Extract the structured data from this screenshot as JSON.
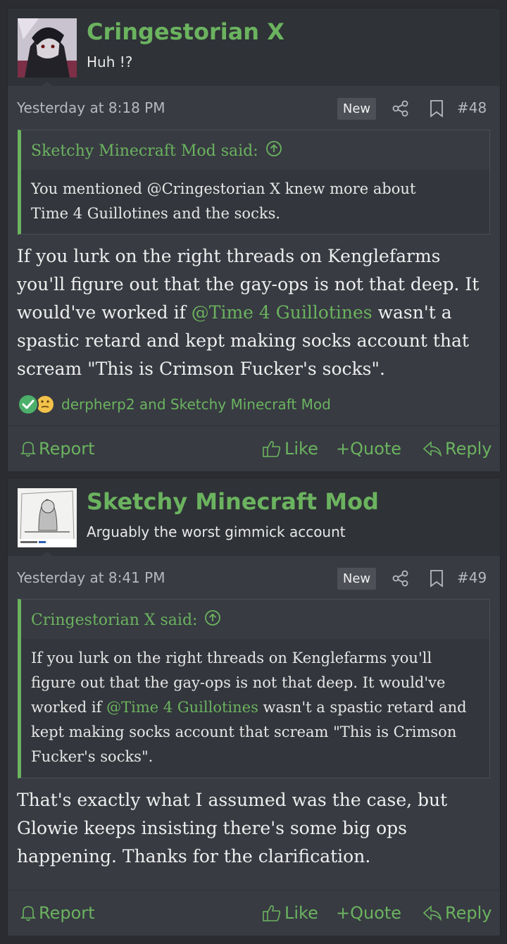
{
  "posts": [
    {
      "username": "Cringestorian X",
      "user_title": "Huh !?",
      "date": "Yesterday at 8:18 PM",
      "badge": "New",
      "number": "#48",
      "quote": {
        "author": "Sketchy Minecraft Mod said:",
        "lines": [
          "You mentioned @Cringestorian X knew more about",
          "Time 4 Guillotines and the socks."
        ]
      },
      "message": {
        "line1": "If you lurk on the right threads on Kenglefarms",
        "line2": "you'll figure out that the gay-ops is not that deep. It",
        "line3_pre": "would've worked if ",
        "line3_mention": "@Time 4 Guillotines",
        "line3_post": " wasn't a",
        "line4": "spastic retard and kept making socks account that",
        "line5": "scream \"This is Crimson Fucker's socks\"."
      },
      "reactions": "derpherp2 and Sketchy Minecraft Mod",
      "footer": {
        "report": "Report",
        "like": "Like",
        "quote": "+Quote",
        "reply": "Reply"
      }
    },
    {
      "username": "Sketchy Minecraft Mod",
      "user_title": "Arguably the worst gimmick account",
      "date": "Yesterday at 8:41 PM",
      "badge": "New",
      "number": "#49",
      "quote": {
        "author": "Cringestorian X said:",
        "line1": "If you lurk on the right threads on Kenglefarms you'll",
        "line2": "figure out that the gay-ops is not that deep. It would've",
        "line3_pre": "worked if ",
        "line3_mention": "@Time 4 Guillotines",
        "line3_post": " wasn't a spastic retard and",
        "line4": "kept making socks account that scream \"This is Crimson",
        "line5": "Fucker's socks\"."
      },
      "message": {
        "line1": "That's exactly what I assumed was the case, but",
        "line2": "Glowie keeps insisting there's some big ops",
        "line3": "happening. Thanks for the clarification."
      },
      "footer": {
        "report": "Report",
        "like": "Like",
        "quote": "+Quote",
        "reply": "Reply"
      }
    }
  ],
  "colors": {
    "accent": "#6bb35f",
    "background": "#2a2c31",
    "panel": "#383b42"
  },
  "icons": [
    "share-icon",
    "bookmark-icon",
    "arrow-up-circle-icon",
    "bell-icon",
    "thumbs-up-icon",
    "reply-arrow-icon",
    "check-reaction-icon",
    "thinking-reaction-icon"
  ]
}
